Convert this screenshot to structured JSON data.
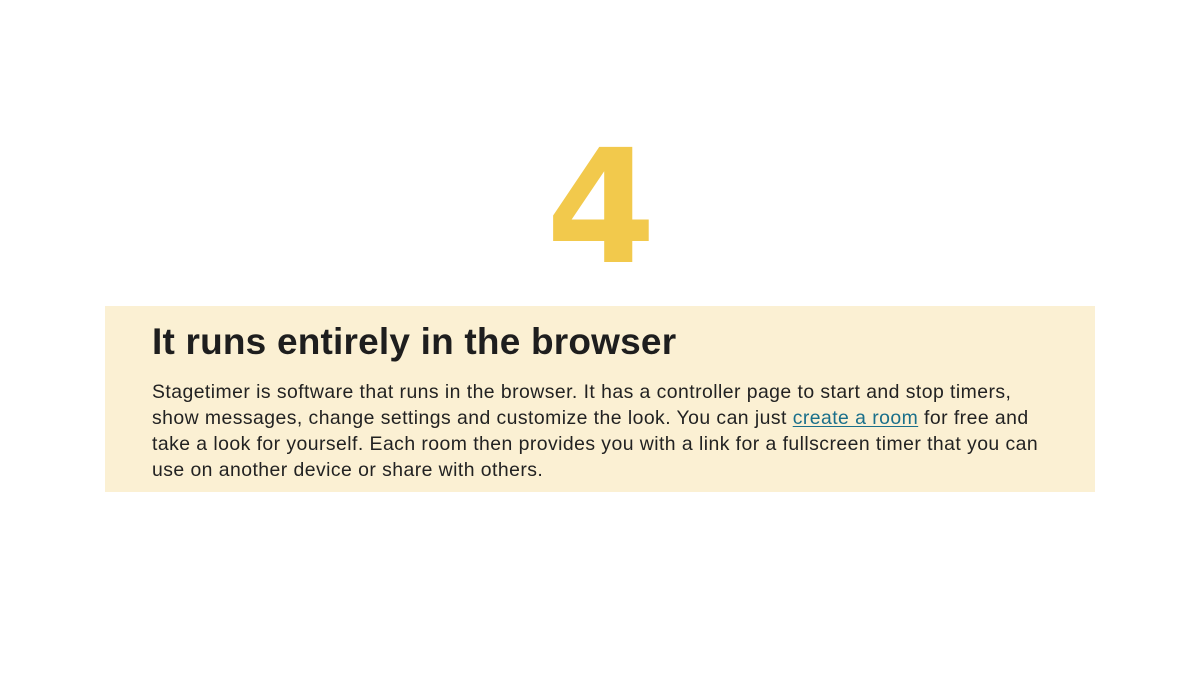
{
  "colors": {
    "accent_number": "#f2c94c",
    "card_background": "#fbf0d3",
    "link": "#1a6f8a",
    "page_background": "#ffffff"
  },
  "step": {
    "number": "4"
  },
  "feature_card": {
    "title": "It runs entirely in the browser",
    "body_before_link": "Stagetimer is software that runs in the browser. It has a controller page to start and stop timers, show messages, change settings and customize the look. You can just ",
    "link_text": "create a room",
    "body_after_link": " for free and take a look for yourself. Each room then provides you with a link for a fullscreen timer that you can use on another device or share with others."
  }
}
